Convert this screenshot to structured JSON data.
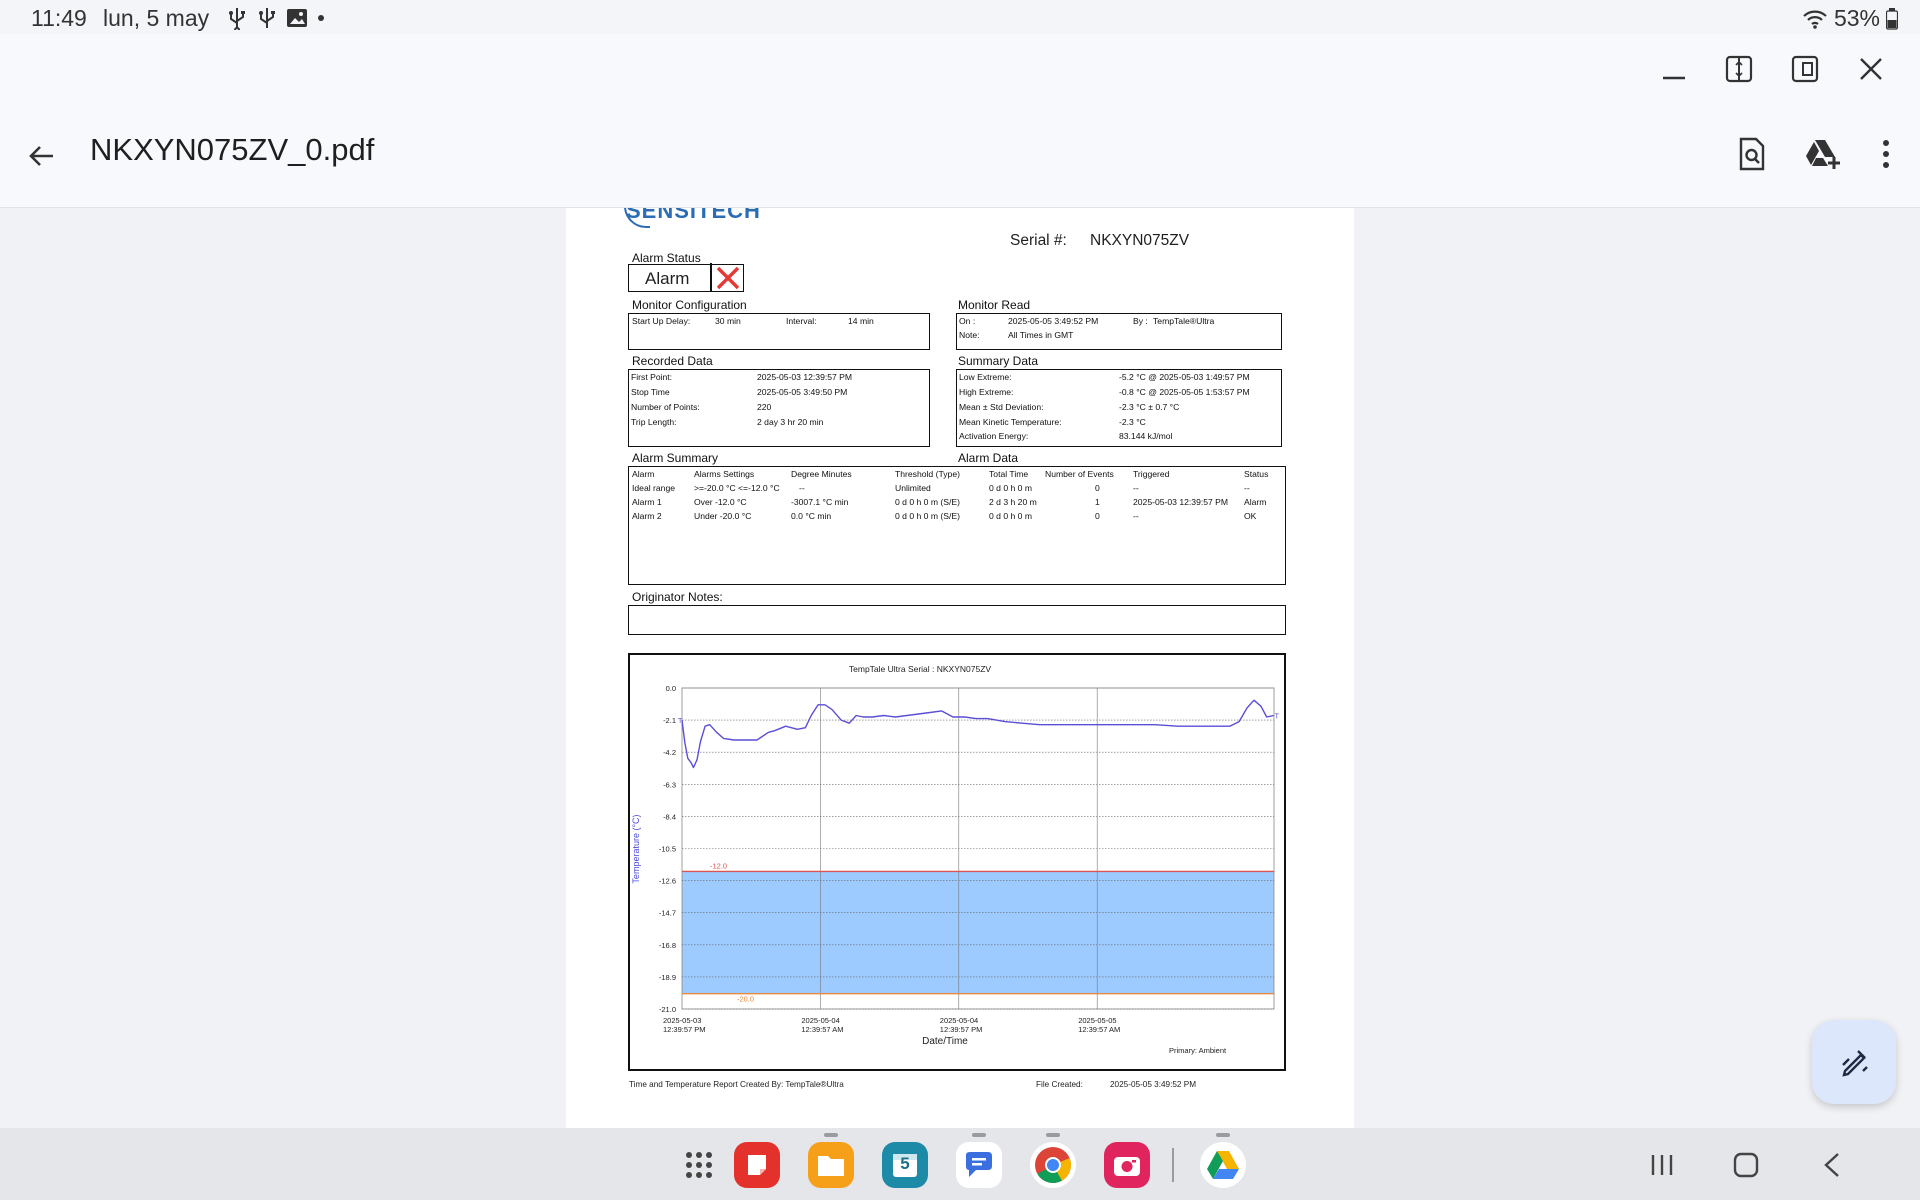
{
  "status_bar": {
    "time": "11:49",
    "date": "lun, 5 may",
    "battery": "53%",
    "icons": [
      "usb-icon",
      "usb-icon",
      "image-icon",
      "dot-icon",
      "wifi-icon",
      "battery-icon"
    ]
  },
  "app_bar": {
    "title": "NKXYN075ZV_0.pdf",
    "actions": [
      "search-in-document-icon",
      "drive-add-icon",
      "more-vertical-icon"
    ]
  },
  "document": {
    "logo_text": "SENSITECH",
    "serial_label": "Serial #:",
    "serial_value": "NKXYN075ZV",
    "alarm_status_label": "Alarm Status",
    "alarm_status_value": "Alarm",
    "monitor_config": {
      "title": "Monitor Configuration",
      "startup_label": "Start Up Delay:",
      "startup_value": "30 min",
      "interval_label": "Interval:",
      "interval_value": "14 min"
    },
    "monitor_read": {
      "title": "Monitor Read",
      "on_label": "On :",
      "on_value": "2025-05-05  3:49:52 PM",
      "by_label": "By :",
      "by_value": "TempTale®Ultra",
      "note_label": "Note:",
      "note_value": "All Times in GMT"
    },
    "recorded": {
      "title": "Recorded Data",
      "rows": [
        {
          "label": "First Point:",
          "value": "2025-05-03 12:39:57 PM"
        },
        {
          "label": "Stop Time",
          "value": "2025-05-05  3:49:50 PM"
        },
        {
          "label": "Number of Points:",
          "value": "220"
        },
        {
          "label": "Trip Length:",
          "value": "2 day 3 hr 20 min"
        }
      ]
    },
    "summary": {
      "title": "Summary Data",
      "rows": [
        {
          "label": "Low Extreme:",
          "value": "-5.2 °C @ 2025-05-03  1:49:57 PM"
        },
        {
          "label": "High Extreme:",
          "value": "-0.8 °C @ 2025-05-05  1:53:57 PM"
        },
        {
          "label": "Mean ± Std Deviation:",
          "value": "-2.3 °C ± 0.7 °C"
        },
        {
          "label": "Mean Kinetic Temperature:",
          "value": "-2.3 °C"
        },
        {
          "label": "Activation Energy:",
          "value": "83.144 kJ/mol"
        }
      ]
    },
    "alarm_summary_title": "Alarm Summary",
    "alarm_data_title": "Alarm Data",
    "alarm_table": {
      "headers": [
        "Alarm",
        "Alarms Settings",
        "Degree Minutes",
        "Threshold (Type)",
        "Total Time",
        "Number of Events",
        "Triggered",
        "Status"
      ],
      "rows": [
        [
          "Ideal range",
          ">=-20.0 °C <=-12.0 °C",
          "--",
          "Unlimited",
          "0 d 0 h 0 m",
          "0",
          "--",
          "--"
        ],
        [
          "Alarm 1",
          "Over -12.0 °C",
          "-3007.1 °C min",
          "0 d 0 h 0 m (S/E)",
          "2 d 3 h 20 m",
          "1",
          "2025-05-03 12:39:57 PM",
          "Alarm"
        ],
        [
          "Alarm 2",
          "Under -20.0 °C",
          "0.0 °C min",
          "0 d 0 h 0 m (S/E)",
          "0 d 0 h 0 m",
          "0",
          "--",
          "OK"
        ]
      ]
    },
    "originator_notes_label": "Originator Notes:",
    "footer_left": "Time and Temperature Report Created By:  TempTale®Ultra",
    "footer_file_label": "File Created:",
    "footer_file_value": "2025-05-05  3:49:52 PM"
  },
  "chart_data": {
    "type": "line",
    "title": "TempTale Ultra  Serial : NKXYN075ZV",
    "xlabel": "Date/Time",
    "ylabel": "Temperature  (°C)",
    "legend_note": "Primary: Ambient",
    "ylim": [
      -21.0,
      0.0
    ],
    "y_ticks": [
      "0.0",
      "-2.1",
      "-4.2",
      "-6.3",
      "-8.4",
      "-10.5",
      "-12.6",
      "-14.7",
      "-16.8",
      "-18.9",
      "-21.0"
    ],
    "x_ticks": [
      {
        "date": "2025-05-03",
        "time": "12:39:57 PM"
      },
      {
        "date": "2025-05-04",
        "time": "12:39:57 AM"
      },
      {
        "date": "2025-05-04",
        "time": "12:39:57 PM"
      },
      {
        "date": "2025-05-05",
        "time": "12:39:57 AM"
      }
    ],
    "x_hours_range": [
      0,
      51.33
    ],
    "x_tick_hours": [
      0,
      12,
      24,
      36
    ],
    "grid": true,
    "limit_lines": [
      {
        "value": -12.0,
        "label": "-12.0",
        "color": "#d9534f"
      },
      {
        "value": -20.0,
        "label": "-20.0",
        "color": "#e8893b"
      }
    ],
    "ideal_band": {
      "from": -20.0,
      "to": -12.0,
      "color": "#9ecbff"
    },
    "series_color": "#5a4fd6",
    "start_marker": "T",
    "end_marker": "T",
    "series": [
      {
        "x_hours": [
          0,
          0.25,
          0.5,
          0.8,
          1.0,
          1.3,
          1.6,
          2.0,
          2.4,
          3.0,
          3.6,
          4.5,
          5.5,
          6.5,
          7.5,
          8.0,
          9.0,
          10.0,
          10.7,
          11.2,
          11.8,
          12.4,
          13.0,
          13.8,
          14.5,
          15.1,
          15.7,
          16.5,
          17.5,
          18.5,
          19.5,
          20.5,
          21.5,
          22.5,
          23.5,
          24.5,
          25.5,
          26.5,
          28.0,
          29.5,
          31.0,
          33.0,
          35.0,
          37.0,
          39.0,
          41.0,
          43.0,
          45.0,
          46.5,
          47.5,
          48.3,
          49.0,
          49.6,
          50.2,
          50.7,
          51.3
        ],
        "values": [
          -2.1,
          -3.6,
          -4.6,
          -4.9,
          -5.2,
          -4.7,
          -3.5,
          -2.5,
          -2.4,
          -2.9,
          -3.3,
          -3.4,
          -3.4,
          -3.4,
          -2.9,
          -2.8,
          -2.5,
          -2.7,
          -2.6,
          -1.8,
          -1.1,
          -1.1,
          -1.4,
          -2.1,
          -2.3,
          -1.8,
          -1.9,
          -1.9,
          -1.8,
          -1.9,
          -1.8,
          -1.7,
          -1.6,
          -1.5,
          -1.9,
          -1.9,
          -2.0,
          -2.0,
          -2.2,
          -2.3,
          -2.4,
          -2.4,
          -2.4,
          -2.4,
          -2.4,
          -2.4,
          -2.5,
          -2.5,
          -2.5,
          -2.5,
          -2.2,
          -1.3,
          -0.8,
          -1.2,
          -1.9,
          -1.8
        ]
      }
    ]
  },
  "taskbar": {
    "calendar_day": "5",
    "apps": [
      "apps-grid-icon",
      "notes-app-icon",
      "files-app-icon",
      "calendar-app-icon",
      "messages-app-icon",
      "chrome-app-icon",
      "camera-app-icon",
      "drive-app-icon"
    ],
    "nav": [
      "recents-icon",
      "home-icon",
      "back-nav-icon"
    ]
  },
  "colors": {
    "accent": "#2a6db5",
    "alarm_red": "#e53935",
    "fab_bg": "#dde7fb"
  }
}
